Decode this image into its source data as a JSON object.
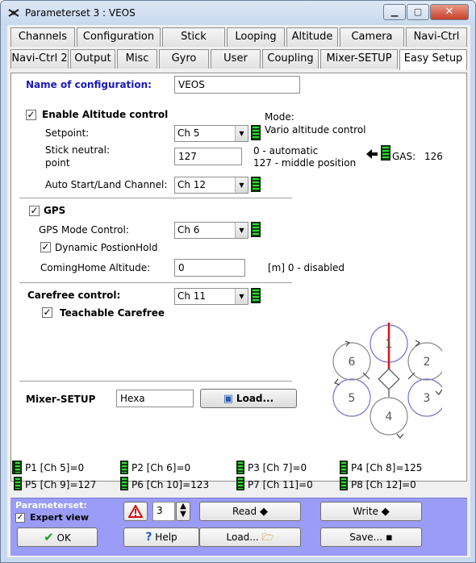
{
  "window": {
    "title": "Parameterset 3 : VEOS"
  },
  "tabs_row1": [
    "Channels",
    "Configuration",
    "Stick",
    "Looping",
    "Altitude",
    "Camera",
    "Navi-Ctrl"
  ],
  "tabs_row2": [
    "Navi-Ctrl 2",
    "Output",
    "Misc",
    "Gyro",
    "User",
    "Coupling",
    "Mixer-SETUP",
    "Easy Setup"
  ],
  "active_tab": "Easy Setup",
  "config": {
    "label": "Name of configuration:",
    "value": "VEOS"
  },
  "altitude": {
    "enable_label": "Enable Altitude control",
    "enabled": true,
    "mode_label": "Mode:",
    "mode_value": "Vario altitude control",
    "setpoint_label": "Setpoint:",
    "setpoint_value": "Ch 5",
    "stick_neutral_label_1": "Stick neutral:",
    "stick_neutral_label_2": "point",
    "stick_neutral_value": "127",
    "hint_1": "0 - automatic",
    "hint_2": "127 - middle position",
    "gas_label": "GAS:",
    "gas_value": "126",
    "autostart_label": "Auto Start/Land Channel:",
    "autostart_value": "Ch 12"
  },
  "gps": {
    "label": "GPS",
    "enabled": true,
    "mode_control_label": "GPS Mode Control:",
    "mode_control_value": "Ch 6",
    "dynamic_label": "Dynamic PostionHold",
    "dynamic_checked": true,
    "cominghome_label": "ComingHome Altitude:",
    "cominghome_value": "0",
    "cominghome_hint": "[m]  0 - disabled"
  },
  "carefree": {
    "label": "Carefree control:",
    "value": "Ch 11",
    "teachable_label": "Teachable Carefree",
    "teachable_checked": true
  },
  "mixer": {
    "label": "Mixer-SETUP",
    "value": "Hexa",
    "load_label": "Load..."
  },
  "motors": [
    "1",
    "2",
    "3",
    "4",
    "5",
    "6"
  ],
  "poti_status": [
    "P1 [Ch 5]=0",
    "P2 [Ch 6]=0",
    "P3 [Ch 7]=0",
    "P4 [Ch 8]=125",
    "P5 [Ch 9]=127",
    "P6 [Ch 10]=123",
    "P7 [Ch 11]=0",
    "P8 [Ch 12]=0"
  ],
  "bottom": {
    "parameterset_label": "Parameterset:",
    "expert_label": "Expert view",
    "expert_checked": true,
    "ok_label": "OK",
    "set_number": "3",
    "help_label": "Help",
    "read_label": "Read",
    "load_label": "Load...",
    "write_label": "Write",
    "save_label": "Save..."
  },
  "colors": {
    "title_blue": "#1a1ab8",
    "led_green": "#2fdc2f",
    "bottom_bar": "#9a9cf7",
    "front_motor": "#e01010",
    "rear_motor_ring": "#7070d0"
  }
}
